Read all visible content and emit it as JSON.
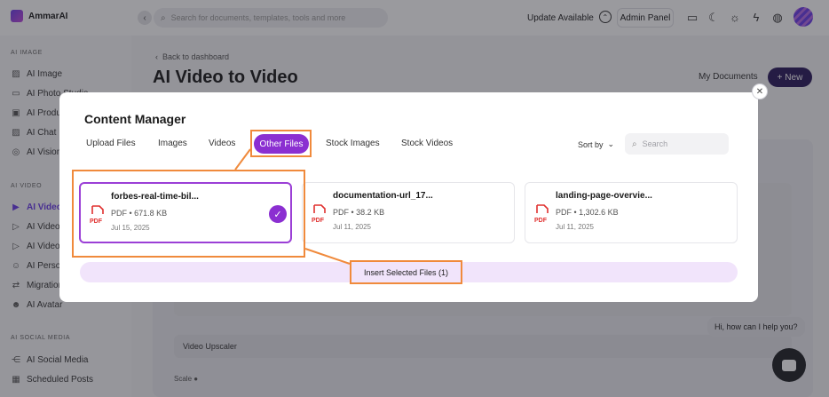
{
  "topbar": {
    "brand": "AmmarAI",
    "search_placeholder": "Search for documents, templates, tools and more",
    "update_label": "Update Available",
    "admin_label": "Admin Panel"
  },
  "sidebar": {
    "sections": [
      {
        "label": "AI IMAGE",
        "items": [
          "AI Image",
          "AI Photo Studio",
          "AI Product",
          "AI Chat I",
          "AI Vision"
        ]
      },
      {
        "label": "AI VIDEO",
        "items": [
          "AI Video",
          "AI Video",
          "AI Video",
          "AI Person",
          "Migration",
          "AI Avatar"
        ]
      },
      {
        "label": "AI SOCIAL MEDIA",
        "items": [
          "AI Social Media",
          "Scheduled Posts"
        ]
      }
    ]
  },
  "main": {
    "back_label": "Back to dashboard",
    "title": "AI Video to Video",
    "my_documents": "My Documents",
    "new_label": "New",
    "field_video_upscaler": "Video Upscaler",
    "label_scale": "Scale"
  },
  "modal": {
    "title": "Content Manager",
    "tabs": [
      "Upload Files",
      "Images",
      "Videos",
      "Other Files",
      "Stock Images",
      "Stock Videos"
    ],
    "active_tab": "Other Files",
    "sort_label": "Sort by",
    "search_placeholder": "Search",
    "files": [
      {
        "name": "forbes-real-time-bil...",
        "meta": "PDF • 671.8 KB",
        "date": "Jul 15, 2025",
        "selected": true
      },
      {
        "name": "documentation-url_17...",
        "meta": "PDF • 38.2 KB",
        "date": "Jul 11, 2025",
        "selected": false
      },
      {
        "name": "landing-page-overvie...",
        "meta": "PDF • 1,302.6 KB",
        "date": "Jul 11, 2025",
        "selected": false
      }
    ],
    "insert_label": "Insert Selected Files (1)",
    "pdf_badge": "PDF"
  },
  "chat": {
    "bubble": "Hi, how can I help you?"
  },
  "colors": {
    "accent": "#8b2fd1",
    "highlight": "#f08a3c",
    "pdf_red": "#e0302f"
  }
}
